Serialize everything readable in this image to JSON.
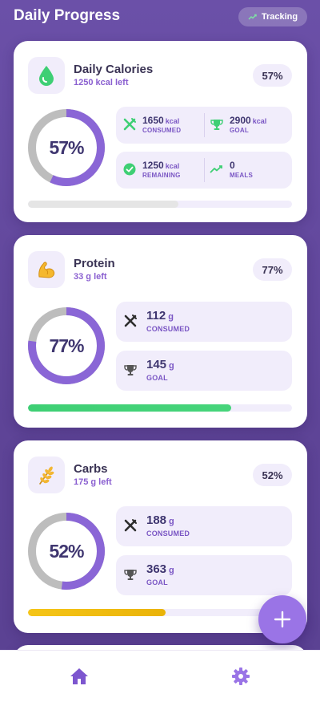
{
  "header": {
    "title": "Daily Progress",
    "tracking_label": "Tracking"
  },
  "colors": {
    "accent": "#8a5fd0",
    "ring_track": "#bdbdbd",
    "calories_fill": "#e5e5e5",
    "protein_fill": "#3ecf74",
    "carbs_fill": "#f2c20e",
    "stat_icon_green": "#3ecf74"
  },
  "cards": {
    "calories": {
      "icon": "water-drop-icon",
      "title": "Daily Calories",
      "subtitle": "1250 kcal left",
      "percent": "57%",
      "progress": 0.57,
      "stats": {
        "consumed": {
          "value": "1650",
          "unit": "kcal",
          "label": "CONSUMED",
          "icon": "utensils-icon"
        },
        "goal": {
          "value": "2900",
          "unit": "kcal",
          "label": "GOAL",
          "icon": "trophy-icon"
        },
        "remaining": {
          "value": "1250",
          "unit": "kcal",
          "label": "REMAINING",
          "icon": "check-circle-icon"
        },
        "meals": {
          "value": "0",
          "label": "MEALS",
          "icon": "trend-up-icon"
        }
      }
    },
    "protein": {
      "icon": "flexed-biceps-icon",
      "title": "Protein",
      "subtitle": "33 g left",
      "percent": "77%",
      "progress": 0.77,
      "stats": {
        "consumed": {
          "value": "112",
          "unit": "g",
          "label": "CONSUMED",
          "icon": "utensils-icon"
        },
        "goal": {
          "value": "145",
          "unit": "g",
          "label": "GOAL",
          "icon": "trophy-icon"
        }
      }
    },
    "carbs": {
      "icon": "wheat-icon",
      "title": "Carbs",
      "subtitle": "175 g left",
      "percent": "52%",
      "progress": 0.52,
      "stats": {
        "consumed": {
          "value": "188",
          "unit": "g",
          "label": "CONSUMED",
          "icon": "utensils-icon"
        },
        "goal": {
          "value": "363",
          "unit": "g",
          "label": "GOAL",
          "icon": "trophy-icon"
        }
      }
    }
  },
  "fab": {
    "icon": "plus-icon"
  },
  "bottom_nav": {
    "items": [
      {
        "icon": "home-icon"
      },
      {
        "icon": "gear-icon"
      }
    ]
  }
}
